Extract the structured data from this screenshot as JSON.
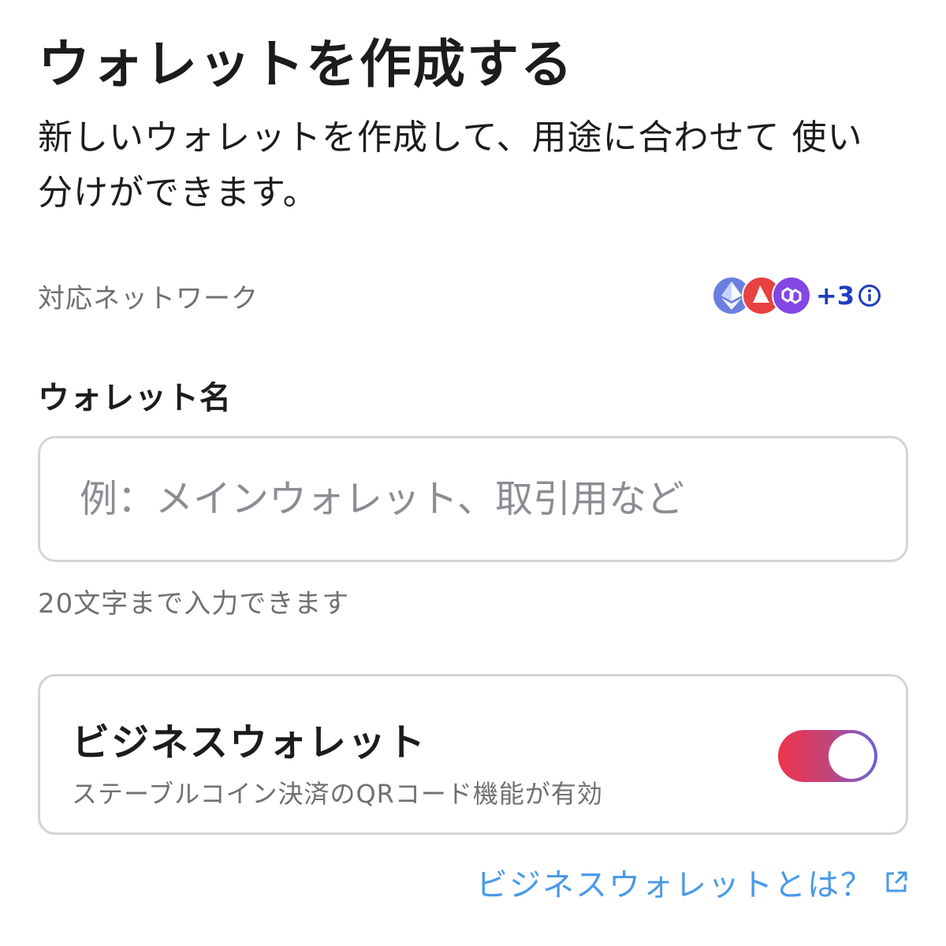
{
  "header": {
    "title": "ウォレットを作成する",
    "subtitle": "新しいウォレットを作成して、用途に合わせて 使い分けができます。"
  },
  "network": {
    "label": "対応ネットワーク",
    "chains": [
      "ethereum-icon",
      "avalanche-icon",
      "polygon-icon"
    ],
    "more_count": "+3",
    "colors": {
      "ethereum": "#6a7fe0",
      "avalanche": "#e84142",
      "polygon": "#8247e5",
      "count": "#1f3fbf"
    }
  },
  "wallet_name": {
    "label": "ウォレット名",
    "value": "",
    "placeholder": "例：メインウォレット、取引用など",
    "helper": "20文字まで入力できます"
  },
  "business_wallet": {
    "title": "ビジネスウォレット",
    "description": "ステーブルコイン決済のQRコード機能が有効",
    "enabled": true,
    "toggle_gradient": [
      "#f0334a",
      "#6a62d9"
    ]
  },
  "help_link": {
    "label": "ビジネスウォレットとは？",
    "icon": "external-link-icon",
    "color": "#4a9ae8"
  }
}
